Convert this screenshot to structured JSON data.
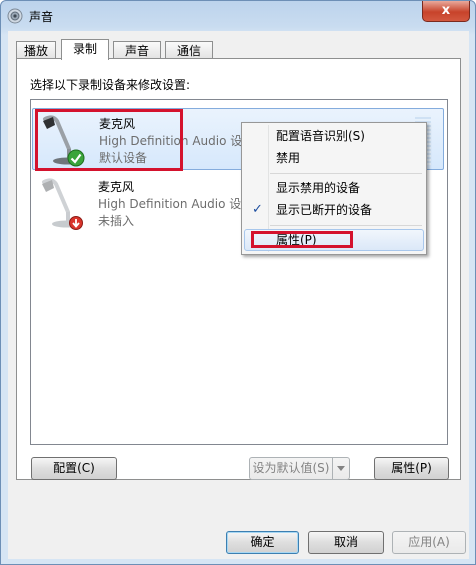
{
  "window": {
    "title": "声音",
    "close_label": "x"
  },
  "tabs": [
    {
      "label": "播放",
      "active": false
    },
    {
      "label": "录制",
      "active": true
    },
    {
      "label": "声音",
      "active": false
    },
    {
      "label": "通信",
      "active": false
    }
  ],
  "panel": {
    "prompt": "选择以下录制设备来修改设置:"
  },
  "devices": [
    {
      "name": "麦克风",
      "driver": "High Definition Audio 设备",
      "status": "默认设备",
      "selected": true,
      "icon": "microphone-icon",
      "badge": "default-check-icon"
    },
    {
      "name": "麦克风",
      "driver": "High Definition Audio 设备",
      "status": "未插入",
      "selected": false,
      "icon": "microphone-icon",
      "badge": "unplugged-arrow-icon"
    }
  ],
  "context_menu": {
    "items": [
      {
        "label": "配置语音识别(S)"
      },
      {
        "label": "禁用"
      },
      {
        "label": "显示禁用的设备"
      },
      {
        "label": "显示已断开的设备",
        "checked": true
      },
      {
        "label": "属性(P)",
        "highlighted": true
      }
    ],
    "check_glyph": "✓"
  },
  "panel_buttons": {
    "configure": "配置(C)",
    "set_default": "设为默认值(S)",
    "properties": "属性(P)"
  },
  "dialog_buttons": {
    "ok": "确定",
    "cancel": "取消",
    "apply": "应用(A)"
  },
  "colors": {
    "highlight_box": "#d4122d",
    "selection": "#d6e8fc",
    "close_button": "#c7432b"
  }
}
